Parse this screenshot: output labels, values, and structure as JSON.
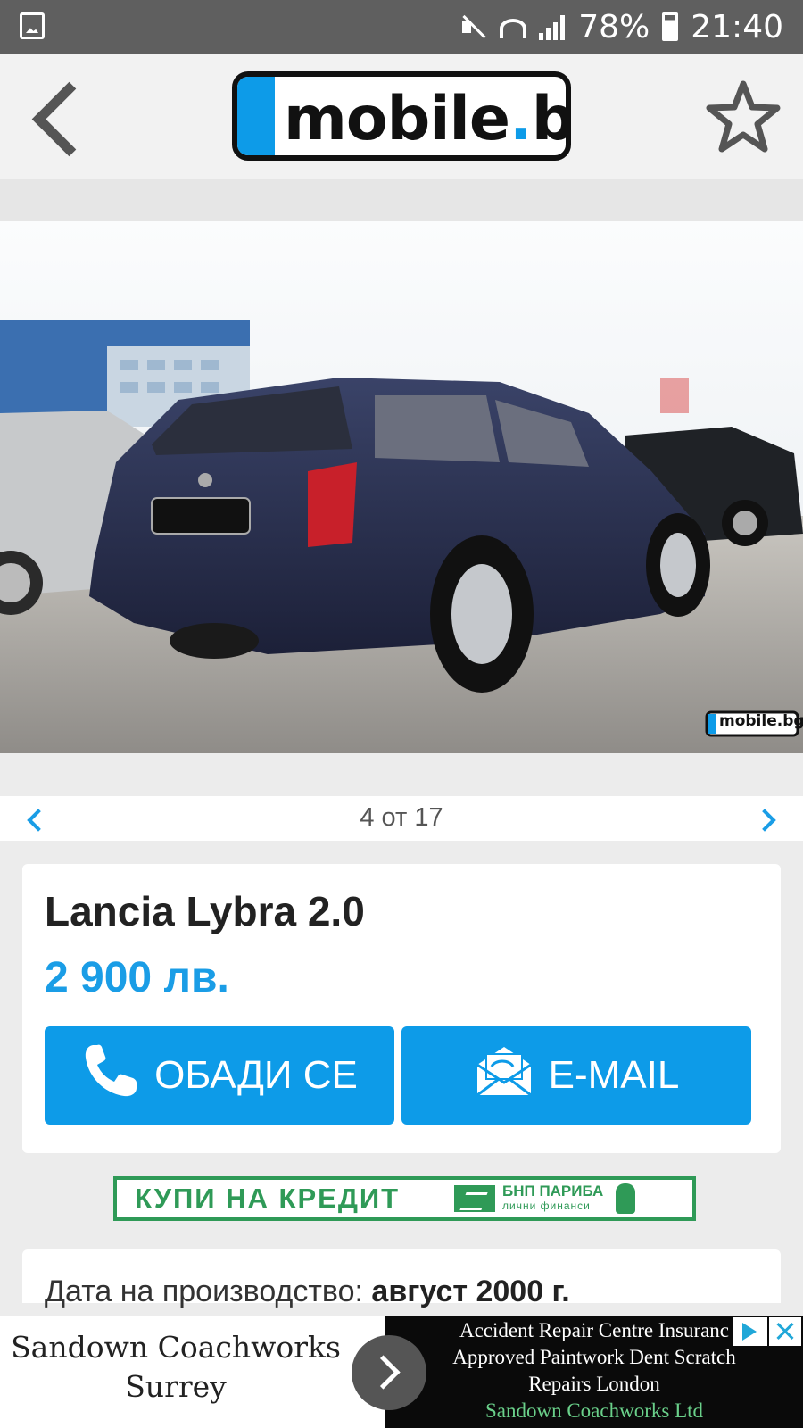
{
  "status_bar": {
    "battery": "78%",
    "time": "21:40",
    "icons": [
      "gallery-icon",
      "mute-icon",
      "wifi-icon",
      "signal-icon",
      "battery-icon"
    ]
  },
  "app_bar": {
    "logo_text": "mobile",
    "logo_dot": ".",
    "logo_tld": "bg",
    "icons": [
      "back-arrow-icon",
      "star-icon"
    ]
  },
  "gallery": {
    "watermark": "mobile.bg",
    "counter": "4 от 17",
    "icons": [
      "chevron-left-icon",
      "chevron-right-icon"
    ]
  },
  "listing": {
    "title": "Lancia Lybra 2.0",
    "price": "2 900 лв.",
    "call_label": "ОБАДИ СЕ",
    "email_label": "E-MAIL"
  },
  "credit_banner": {
    "cta": "КУПИ НА КРЕДИТ",
    "bank_name": "БНП ПАРИБА",
    "bank_sub": "лични финанси"
  },
  "details": {
    "production_label": "Дата на производство:",
    "production_value": "август 2000 г."
  },
  "ad": {
    "advertiser_title": "Sandown Coachworks Surrey",
    "line1": "Accident Repair Centre Insuranc",
    "line2": "Approved Paintwork Dent Scratch",
    "line3": "Repairs London",
    "advertiser": "Sandown Coachworks Ltd"
  },
  "colors": {
    "accent": "#0d9be8",
    "status_bar": "#5f5f5f",
    "credit_green": "#2f9a57"
  }
}
